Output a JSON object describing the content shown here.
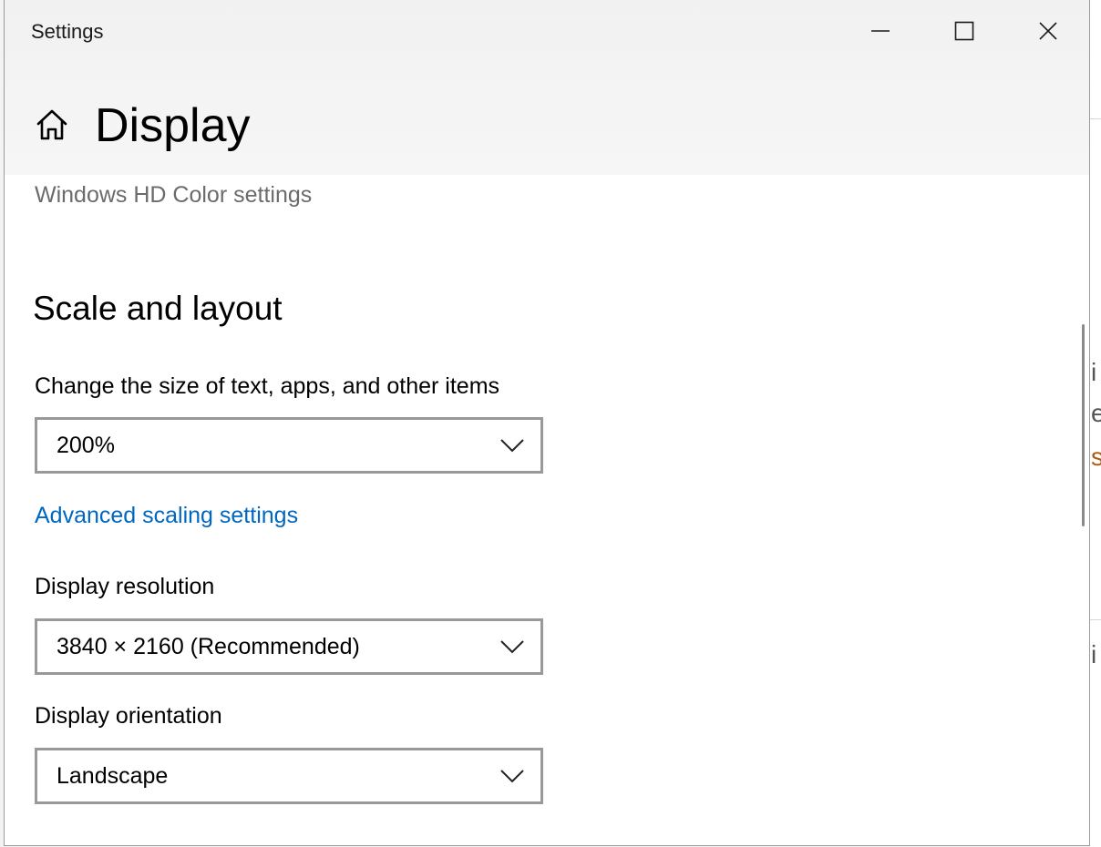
{
  "window": {
    "title": "Settings",
    "controls": [
      "minimize-icon",
      "maximize-icon",
      "close-icon"
    ]
  },
  "page": {
    "icon": "home-icon",
    "title": "Display"
  },
  "hd_color_link": "Windows HD Color settings",
  "scale_layout": {
    "heading": "Scale and layout",
    "size_label": "Change the size of text, apps, and other items",
    "size_value": "200%",
    "advanced_link": "Advanced scaling settings",
    "resolution_label": "Display resolution",
    "resolution_value": "3840 × 2160 (Recommended)",
    "orientation_label": "Display orientation",
    "orientation_value": "Landscape"
  },
  "colors": {
    "link": "#0067c0",
    "dropdown_border": "#999999",
    "header_bg": "#f3f3f3"
  }
}
